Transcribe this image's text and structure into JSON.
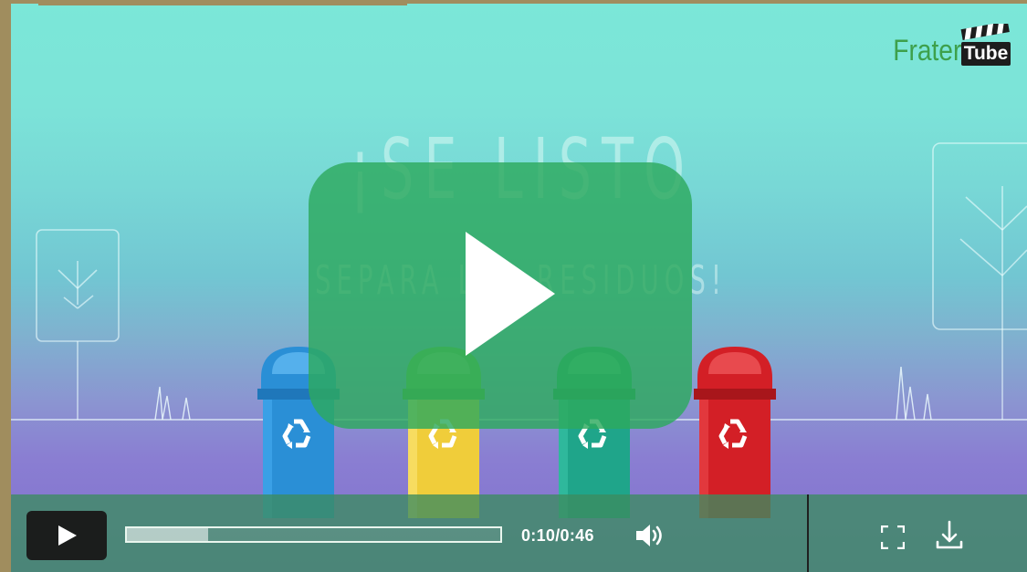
{
  "video": {
    "headline": "¡SE LISTO",
    "subline": "SEPARA LOS RESIDUOS!",
    "logo": {
      "text_frater": "Frater",
      "text_tube": "Tube",
      "icon": "clapperboard-icon"
    },
    "bins": [
      {
        "color": "#2a8fd6",
        "icon": "recycle-icon"
      },
      {
        "color": "#f0cd3a",
        "icon": "recycle-icon"
      },
      {
        "color": "#1fa58a",
        "icon": "recycle-icon"
      },
      {
        "color": "#d31f26",
        "icon": "recycle-icon"
      }
    ],
    "big_play_icon": "play-icon"
  },
  "controls": {
    "play_icon": "play-icon",
    "progress_fraction": 0.217,
    "time_current": "0:10",
    "time_total": "0:46",
    "time_display": "0:10/0:46",
    "volume_icon": "volume-icon",
    "fullscreen_icon": "fullscreen-icon",
    "download_icon": "download-icon"
  },
  "colors": {
    "accent": "#2daa5e",
    "control_bar": "#3c8c60",
    "logo_green": "#3da04b"
  }
}
